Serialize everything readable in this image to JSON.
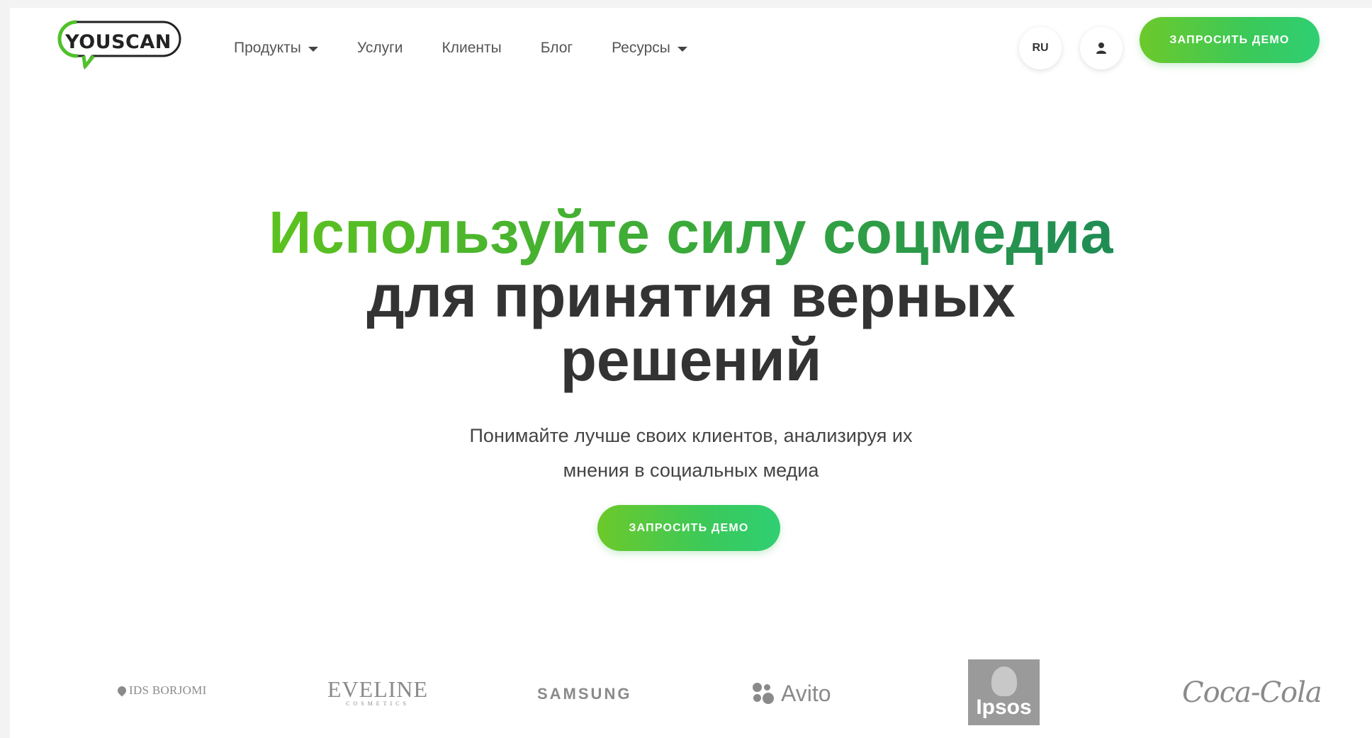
{
  "header": {
    "logo_text": "YOUSCAN",
    "nav": [
      {
        "label": "Продукты",
        "has_dropdown": true
      },
      {
        "label": "Услуги",
        "has_dropdown": false
      },
      {
        "label": "Клиенты",
        "has_dropdown": false
      },
      {
        "label": "Блог",
        "has_dropdown": false
      },
      {
        "label": "Ресурсы",
        "has_dropdown": true
      }
    ],
    "lang_label": "RU",
    "user_icon": "user-icon",
    "demo_label": "ЗАПРОСИТЬ ДЕМО"
  },
  "hero": {
    "title_highlight": "Используйте силу соцмедиа",
    "title_rest": "для принятия верных решений",
    "subtitle_line1": "Понимайте лучше своих клиентов, анализируя их",
    "subtitle_line2": "мнения в социальных медиа",
    "cta_label": "ЗАПРОСИТЬ ДЕМО"
  },
  "clients": {
    "borjomi": "IDS BORJOMI",
    "eveline_main": "EVELINE",
    "eveline_sub": "COSMETICS",
    "samsung": "SAMSUNG",
    "avito": "Avito",
    "ipsos": "Ipsos",
    "cocacola": "Coca-Cola"
  },
  "colors": {
    "accent_green": "#4ec63a",
    "text_dark": "#333333",
    "logo_gray": "#8a8a8a"
  }
}
